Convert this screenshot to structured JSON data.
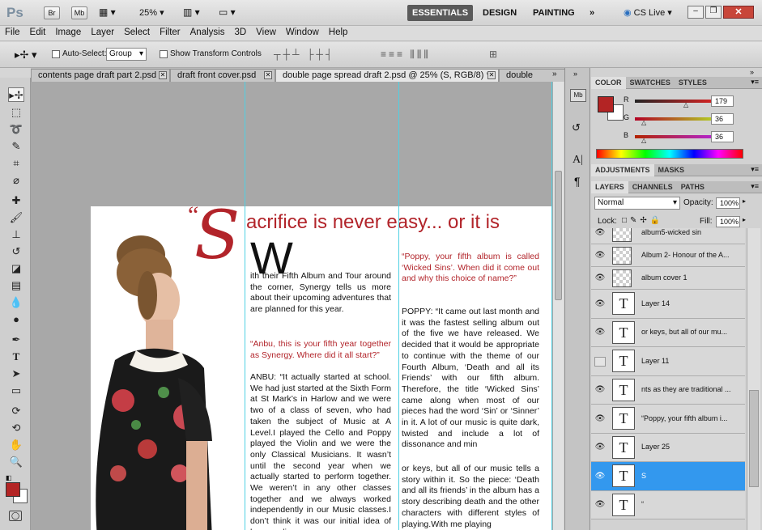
{
  "app": {
    "logo": "Ps",
    "bridge_button": "Br",
    "mini_bridge_button": "Mb",
    "zoom": "25%",
    "workspaces": {
      "essentials": "ESSENTIALS",
      "design": "DESIGN",
      "painting": "PAINTING",
      "more": "»"
    },
    "cs_live": "CS Live"
  },
  "menu": [
    "File",
    "Edit",
    "Image",
    "Layer",
    "Select",
    "Filter",
    "Analysis",
    "3D",
    "View",
    "Window",
    "Help"
  ],
  "options": {
    "auto_select_label": "Auto-Select:",
    "auto_select_value": "Group",
    "transform_label": "Show Transform Controls"
  },
  "tabs": [
    {
      "label": "contents page draft part 2.psd",
      "active": false
    },
    {
      "label": "draft front cover.psd",
      "active": false
    },
    {
      "label": "double page spread draft 2.psd @ 25% (S, RGB/8) *",
      "active": true
    },
    {
      "label": "double",
      "active": false
    }
  ],
  "document": {
    "headline_quote": "“",
    "headline_initial": "S",
    "headline_rest": "acrifice is never easy... or it is",
    "dropcap": "W",
    "col1_intro": "ith their Fifth Album and Tour around the corner, Synergy tells us more about their upcoming adventures that are planned for this year.",
    "col1_question": "“Anbu, this is your fifth year together as Synergy. Where did it all start?”",
    "col1_answer": "ANBU: “It actually started at school. We had just started at the Sixth Form at St Mark’s in Harlow and we were two of a class of seven, who had taken the subject of Music at A Level.I played the Cello and Poppy played the Violin and we were the only Classical Musicians. It wasn’t until the second year when we actually started to perform together. We weren’t in any other classes together and we always worked independently in our Music classes.I don’t think it was our initial idea of how our lives",
    "col2_question": "“Poppy, your fifth album is called ‘Wicked Sins’. When did it come out and why this choice of name?”",
    "col2_answer": "POPPY: “It came out last month and it was the fastest selling album out of the five we have released. We decided that it would be appropriate to continue with the theme of our Fourth Album, ‘Death and all its Friends’ with our fifth album. Therefore, the title ‘Wicked Sins’ came along when most of our pieces had the word ‘Sin’ or ‘Sinner’ in it. A lot of our music is quite dark, twisted and include a lot of dissonance and min",
    "col2_more": "or keys, but all of our music tells a story within it. So the piece: ‘Death and all its friends’ in the album has a story describing death and the other characters with different styles of playing.With me playing"
  },
  "color_panel": {
    "tabs": [
      "COLOR",
      "SWATCHES",
      "STYLES"
    ],
    "r_label": "R",
    "g_label": "G",
    "b_label": "B",
    "r": "179",
    "g": "36",
    "b": "36",
    "foreground": "#b32424"
  },
  "adjustments_panel": {
    "tabs": [
      "ADJUSTMENTS",
      "MASKS"
    ]
  },
  "layers_panel": {
    "tabs": [
      "LAYERS",
      "CHANNELS",
      "PATHS"
    ],
    "blend_mode": "Normal",
    "opacity_label": "Opacity:",
    "opacity": "100%",
    "lock_label": "Lock:",
    "fill_label": "Fill:",
    "fill": "100%",
    "layers": [
      {
        "name": "album5-wicked sin",
        "type": "image",
        "visible": true,
        "selected": false
      },
      {
        "name": "Album 2- Honour of the A...",
        "type": "image",
        "visible": true,
        "selected": false
      },
      {
        "name": "album cover 1",
        "type": "image",
        "visible": true,
        "selected": false
      },
      {
        "name": "Layer 14",
        "type": "text",
        "visible": true,
        "selected": false
      },
      {
        "name": "or keys, but all of our mu...",
        "type": "text",
        "visible": true,
        "selected": false
      },
      {
        "name": "Layer 11",
        "type": "text",
        "visible": false,
        "selected": false
      },
      {
        "name": "nts as they are traditional ...",
        "type": "text",
        "visible": true,
        "selected": false
      },
      {
        "name": "“Poppy, your fifth album i...",
        "type": "text",
        "visible": true,
        "selected": false
      },
      {
        "name": "Layer 25",
        "type": "text",
        "visible": true,
        "selected": false
      },
      {
        "name": "S",
        "type": "text",
        "visible": true,
        "selected": true
      },
      {
        "name": "“",
        "type": "text",
        "visible": true,
        "selected": false
      }
    ]
  },
  "colors": {
    "foreground_swatch": "#b32424",
    "selection": "#3398ee",
    "guide": "#4fd0e3",
    "headline_red": "#b2242a"
  }
}
